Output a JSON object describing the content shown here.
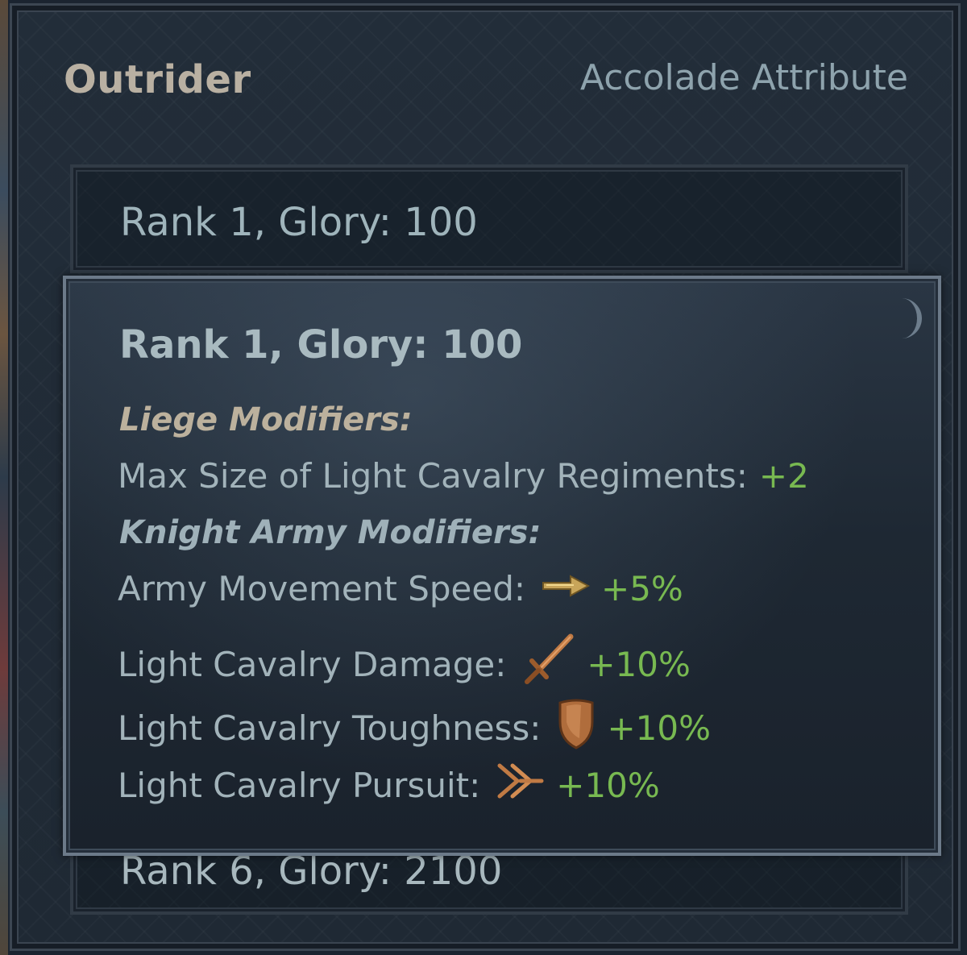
{
  "panel": {
    "title": "Outrider",
    "subtitle": "Accolade Attribute"
  },
  "ranks": [
    {
      "label": "Rank 1, Glory: 100"
    },
    {
      "label": "Rank 6, Glory: 2100"
    }
  ],
  "tooltip": {
    "title": "Rank 1, Glory: 100",
    "liege_header": "Liege Modifiers:",
    "liege_modifiers": [
      {
        "label": "Max Size of Light Cavalry Regiments:",
        "value": "+2",
        "icon": null
      }
    ],
    "knight_header": "Knight Army Modifiers:",
    "knight_modifiers": [
      {
        "label": "Army Movement Speed:",
        "value": "+5%",
        "icon": "movement-arrow-icon"
      },
      {
        "label": "Light Cavalry Damage:",
        "value": "+10%",
        "icon": "sword-icon"
      },
      {
        "label": "Light Cavalry Toughness:",
        "value": "+10%",
        "icon": "shield-icon"
      },
      {
        "label": "Light Cavalry Pursuit:",
        "value": "+10%",
        "icon": "pursuit-chevrons-icon"
      }
    ]
  },
  "colors": {
    "positive_value": "#78b951",
    "icon_bronze": "#b9773f"
  }
}
